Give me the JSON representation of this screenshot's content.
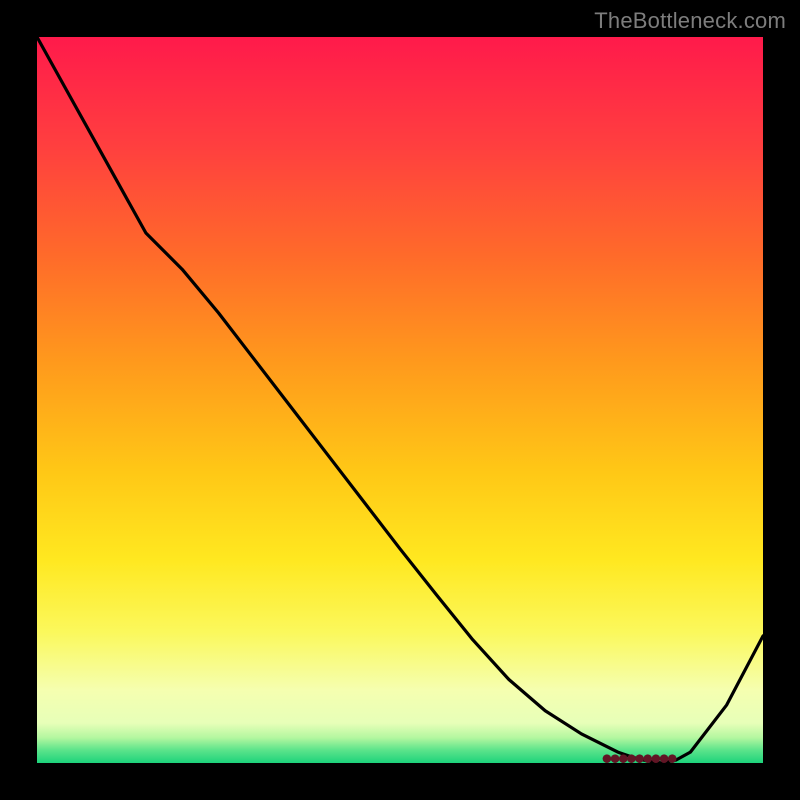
{
  "watermark": "TheBottleneck.com",
  "chart_data": {
    "type": "line",
    "title": "",
    "xlabel": "",
    "ylabel": "",
    "x": [
      0.0,
      0.05,
      0.1,
      0.15,
      0.2,
      0.25,
      0.3,
      0.35,
      0.4,
      0.45,
      0.5,
      0.55,
      0.6,
      0.65,
      0.7,
      0.75,
      0.8,
      0.82,
      0.84,
      0.86,
      0.88,
      0.9,
      0.95,
      1.0
    ],
    "y": [
      1.0,
      0.91,
      0.82,
      0.73,
      0.68,
      0.62,
      0.555,
      0.49,
      0.425,
      0.36,
      0.295,
      0.232,
      0.17,
      0.115,
      0.072,
      0.04,
      0.015,
      0.008,
      0.003,
      0.0,
      0.004,
      0.015,
      0.08,
      0.175
    ],
    "xlim": [
      0,
      1
    ],
    "ylim": [
      0,
      1
    ],
    "grid": false,
    "axes_visible": false,
    "marker": {
      "present": true,
      "x_start": 0.785,
      "x_end": 0.875,
      "y": 0.006,
      "color": "#611525"
    },
    "background_gradient_stops": [
      {
        "offset": 0.0,
        "color": "#ff1a4b"
      },
      {
        "offset": 0.15,
        "color": "#ff3f3f"
      },
      {
        "offset": 0.3,
        "color": "#ff6a2a"
      },
      {
        "offset": 0.45,
        "color": "#ff9a1c"
      },
      {
        "offset": 0.6,
        "color": "#ffc816"
      },
      {
        "offset": 0.72,
        "color": "#ffe820"
      },
      {
        "offset": 0.82,
        "color": "#fbf85c"
      },
      {
        "offset": 0.9,
        "color": "#f5ffb0"
      },
      {
        "offset": 0.945,
        "color": "#e7ffb8"
      },
      {
        "offset": 0.965,
        "color": "#b4f7a0"
      },
      {
        "offset": 0.982,
        "color": "#5de48b"
      },
      {
        "offset": 1.0,
        "color": "#1dd37b"
      }
    ]
  }
}
